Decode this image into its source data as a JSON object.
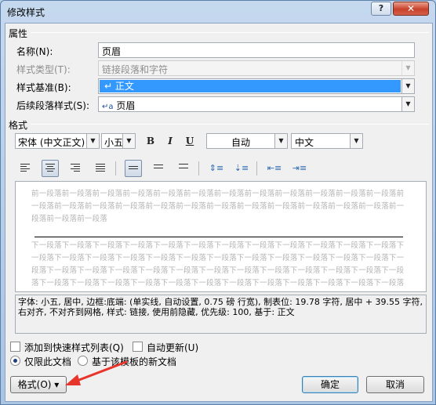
{
  "window": {
    "title": "修改样式",
    "help": "?",
    "close": "✕"
  },
  "properties": {
    "heading": "属性",
    "name_label": "名称(N):",
    "name_value": "页眉",
    "type_label": "样式类型(T):",
    "type_value": "链接段落和字符",
    "based_label": "样式基准(B):",
    "based_icon": "↵",
    "based_value": "正文",
    "next_label": "后续段落样式(S):",
    "next_icon": "↵a",
    "next_value": "页眉"
  },
  "format": {
    "heading": "格式",
    "font": "宋体 (中文正文)",
    "size": "小五",
    "bold": "B",
    "italic": "I",
    "underline": "U",
    "color": "自动",
    "language": "中文"
  },
  "preview": {
    "prev_para": "前一段落前一段落前一段落前一段落前一段落前一段落前一段落前一段落前一段落前一段落前一段落前一段落前一段落前一段落前一段落前一段落前一段落前一段落前一段落前一段落前一段落前一段落前一段落前一段落前一段落前一段落前一段落",
    "next_para": "下一段落下一段落下一段落下一段落下一段落下一段落下一段落下一段落下一段落下一段落下一段落下一段落下一段落下一段落下一段落下一段落下一段落下一段落下一段落下一段落下一段落下一段落下一段落下一段落下一段落下一段落下一段落下一段落下一段落下一段落下一段落下一段落下一段落下一段落下一段落下一段落下一段落下一段落下一段落下一段落下一段落下一段落下一段落下一段落下一段落下一段落下一段落下一段落下一段落下一段落下一段落"
  },
  "description": "字体: 小五, 居中, 边框:底端: (单实线, 自动设置, 0.75 磅 行宽), 制表位: 19.78 字符, 居中 + 39.55 字符, 右对齐, 不对齐到网格, 样式: 链接, 使用前隐藏, 优先级: 100, 基于: 正文",
  "options": {
    "add_to_quick": "添加到快速样式列表(Q)",
    "auto_update": "自动更新(U)",
    "only_this_doc": "仅限此文档",
    "new_docs": "基于该模板的新文档"
  },
  "buttons": {
    "format": "格式(O)",
    "format_arrow": "▾",
    "ok": "确定",
    "cancel": "取消"
  },
  "glyphs": {
    "dropdown": "▼"
  },
  "colors": {
    "selection": "#3399ff",
    "close": "#c7412a",
    "arrow": "#e8352b"
  }
}
